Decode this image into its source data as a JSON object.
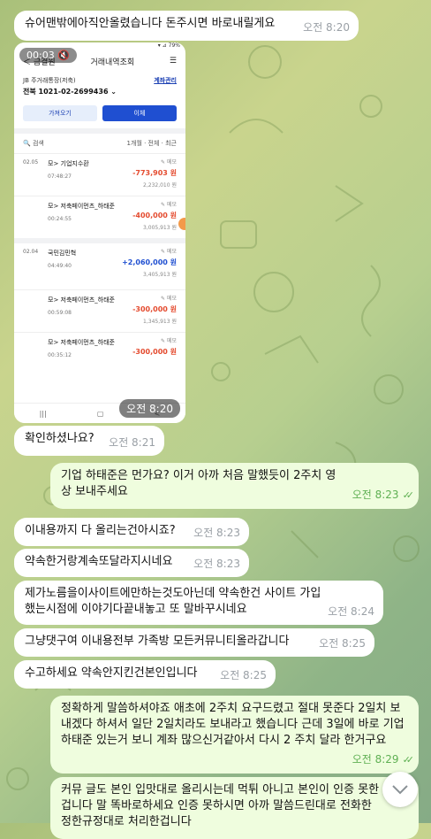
{
  "messages": [
    {
      "text": "슈어맨밖에아직안올렸습니다 돈주시면 바로내릴게요",
      "time": "오전 8:20"
    },
    {
      "text": "확인하셨나요?",
      "time": "오전 8:21"
    },
    {
      "text": "기업 하태준은 먼가요? 이거 아까 처음 말했듯이 2주치 영상 보내주세요",
      "time": "오전 8:23"
    },
    {
      "text": "이내용까지 다 올리는건아시죠?",
      "time": "오전 8:23"
    },
    {
      "text": "약속한거랑계속또달라지시네요",
      "time": "오전 8:23"
    },
    {
      "text": "제가노름을이사이트에만하는것도아닌데 약속한건 사이트 가입했는시점에 이야기다끝내놓고 또 말바꾸시네요",
      "time": "오전 8:24"
    },
    {
      "text": "그냥댓구여 이내용전부 가족방 모든커뮤니티올라갑니다",
      "time": "오전 8:25"
    },
    {
      "text": "수고하세요 약속안지킨건본인입니다",
      "time": "오전 8:25"
    },
    {
      "text": "정확하게 말씀하셔야죠 애초에 2주치 요구드렸고 절대 못준다 2일치 보내겠다 하셔서 일단 2일치라도 보내라고 했습니다 근데 3일에 바로 기업 하태준 있는거 보니 계좌 많으신거같아서 다시 2 주치 달라 한거구요",
      "time": "오전 8:29"
    },
    {
      "text": "커뮤 글도 본인 입맛대로 올리시는데 먹튀 아니고 본인이 인증 못한겁니다 말 똑바로하세요 인증 못하시면 아까 말씀드린대로 전화한 정한규정대로 처리한겁니다",
      "time": ""
    }
  ],
  "media": {
    "video_duration": "00:03",
    "time": "오전 8:20",
    "statusbar": "▾ ⊿ 79%",
    "back_label": "＜  금결원",
    "screen_title": "거래내역조회",
    "bank": "JB 주거래통장(저축)",
    "account": "전북 1021-02-2699436 ⌄",
    "manage": "계좌관리",
    "load_btn": "가져오기",
    "transfer_btn": "이체",
    "search_label": "검색",
    "filter": "1개월 · 전체 · 최근",
    "memo": "✎ 메모",
    "transactions": [
      {
        "date": "02.05",
        "name": "모> 기업지수환",
        "time": "07:48:27",
        "amount": "-773,903 원",
        "balance": "2,232,010 원"
      },
      {
        "date": "",
        "name": "모> 저축페이먼츠_하태준",
        "time": "00:24:55",
        "amount": "-400,000 원",
        "balance": "3,005,913 원"
      },
      {
        "date": "02.04",
        "name": "국민김민혁",
        "time": "04:49:40",
        "amount": "+2,060,000 원",
        "balance": "3,405,913 원"
      },
      {
        "date": "",
        "name": "모> 저축페이먼츠_하태준",
        "time": "00:59:08",
        "amount": "-300,000 원",
        "balance": "1,345,913 원"
      },
      {
        "date": "",
        "name": "모> 저축페이먼츠_하태준",
        "time": "00:35:12",
        "amount": "-300,000 원",
        "balance": ""
      }
    ],
    "nav": [
      "|||",
      "▢",
      "<"
    ]
  },
  "colors": {
    "incoming": "#ffffff",
    "outgoing": "#effdde",
    "time_out": "#5fb053",
    "time_in": "#9aa0a6"
  }
}
